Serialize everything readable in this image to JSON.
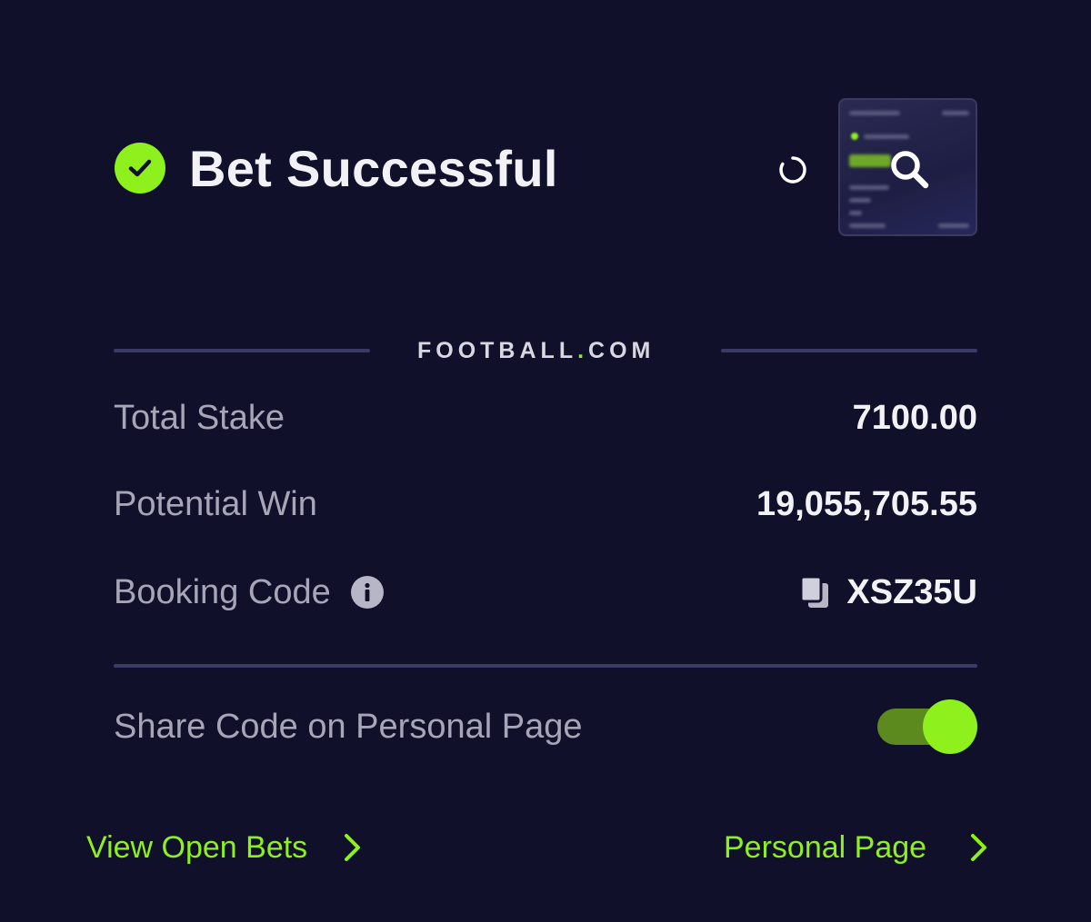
{
  "header": {
    "title": "Bet Successful"
  },
  "brand": {
    "name_part1": "FOOTBALL",
    "name_dot": ".",
    "name_part2": "COM"
  },
  "summary": {
    "total_stake_label": "Total Stake",
    "total_stake_value": "7100.00",
    "potential_win_label": "Potential Win",
    "potential_win_value": "19,055,705.55",
    "booking_code_label": "Booking Code",
    "booking_code_value": "XSZ35U"
  },
  "share": {
    "label": "Share Code on Personal Page",
    "enabled": true
  },
  "links": {
    "view_open_bets": "View Open Bets",
    "personal_page": "Personal Page"
  },
  "colors": {
    "background": "#10102a",
    "accent": "#8ef01c",
    "divider": "#3a3a66",
    "label": "#a6a6b8",
    "value": "#f2f2f6"
  },
  "icons": {
    "status": "check-circle-icon",
    "loading": "spinner-icon",
    "preview": "magnifier-icon",
    "info": "info-icon",
    "copy": "copy-icon",
    "chevron": "chevron-right-icon"
  }
}
